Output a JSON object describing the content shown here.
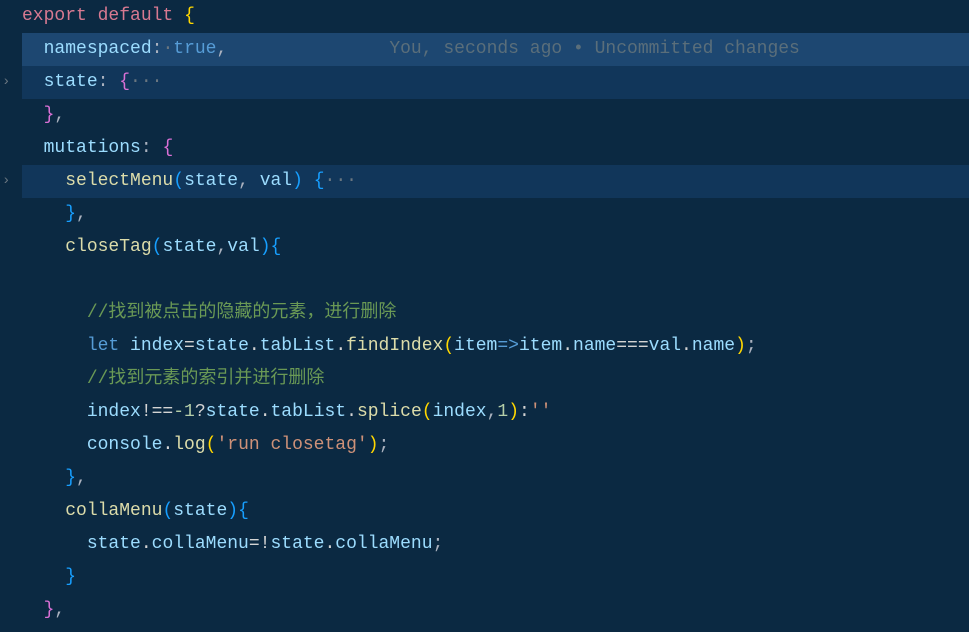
{
  "gitlens": {
    "author": "You,",
    "when": "seconds ago",
    "sep": "•",
    "message": "Uncommitted changes"
  },
  "code": {
    "export": "export",
    "default": "default",
    "namespaced": "namespaced",
    "true": "true",
    "state": "state",
    "mutations": "mutations",
    "selectMenu": "selectMenu",
    "val": "val",
    "closeTag": "closeTag",
    "comment1": "//找到被点击的隐藏的元素，进行删除",
    "let": "let",
    "index": "index",
    "tabList": "tabList",
    "findIndex": "findIndex",
    "item": "item",
    "name": "name",
    "comment2": "//找到元素的索引并进行删除",
    "splice": "splice",
    "one": "1",
    "minus1": "-1",
    "empty": "''",
    "console": "console",
    "log": "log",
    "runClosetag": "'run closetag'",
    "collaMenu": "collaMenu",
    "ellipsis": "···"
  }
}
